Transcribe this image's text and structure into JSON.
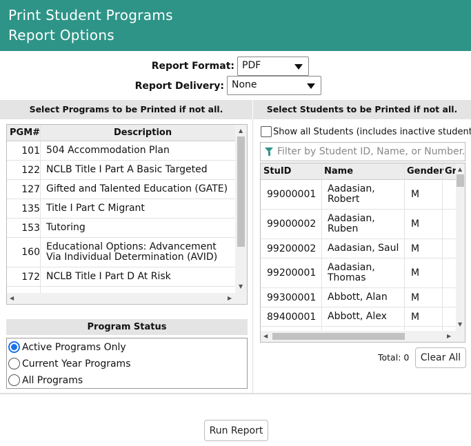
{
  "header": {
    "title_line1": "Print Student Programs",
    "title_line2": "Report Options"
  },
  "report_format": {
    "label": "Report Format:",
    "value": "PDF"
  },
  "report_delivery": {
    "label": "Report Delivery:",
    "value": "None"
  },
  "programs": {
    "section_title": "Select Programs to be Printed if not all.",
    "col_num": "PGM#",
    "col_desc": "Description",
    "rows": [
      {
        "num": "101",
        "desc": "504 Accommodation Plan"
      },
      {
        "num": "122",
        "desc": "NCLB Title I Part A Basic Targeted"
      },
      {
        "num": "127",
        "desc": "Gifted and Talented Education (GATE)"
      },
      {
        "num": "135",
        "desc": "Title I Part C Migrant"
      },
      {
        "num": "153",
        "desc": "Tutoring"
      },
      {
        "num": "160",
        "desc": "Educational Options: Advancement Via Individual Determination (AVID)"
      },
      {
        "num": "172",
        "desc": "NCLB Title I Part D At Risk"
      }
    ]
  },
  "program_status": {
    "title": "Program Status",
    "options": [
      {
        "label": "Active Programs Only",
        "selected": true
      },
      {
        "label": "Current Year Programs",
        "selected": false
      },
      {
        "label": "All Programs",
        "selected": false
      }
    ]
  },
  "students": {
    "section_title": "Select Students to be Printed if not all.",
    "show_all_label": "Show all Students (includes inactive students)",
    "filter_placeholder": "Filter by Student ID, Name, or Number...",
    "col_id": "StuID",
    "col_name": "Name",
    "col_gender": "Gender",
    "col_grade": "Gr",
    "rows": [
      {
        "id": "99000001",
        "name": "Aadasian, Robert",
        "gender": "M"
      },
      {
        "id": "99000002",
        "name": "Aadasian, Ruben",
        "gender": "M"
      },
      {
        "id": "99200002",
        "name": "Aadasian, Saul",
        "gender": "M"
      },
      {
        "id": "99200001",
        "name": "Aadasian, Thomas",
        "gender": "M"
      },
      {
        "id": "99300001",
        "name": "Abbott, Alan",
        "gender": "M"
      },
      {
        "id": "89400001",
        "name": "Abbott, Alex",
        "gender": "M"
      }
    ],
    "total_label": "Total: 0",
    "clear_all_label": "Clear All"
  },
  "run_report_label": "Run Report",
  "colors": {
    "header_bg": "#2e9488",
    "radio_accent": "#1a73e8"
  }
}
